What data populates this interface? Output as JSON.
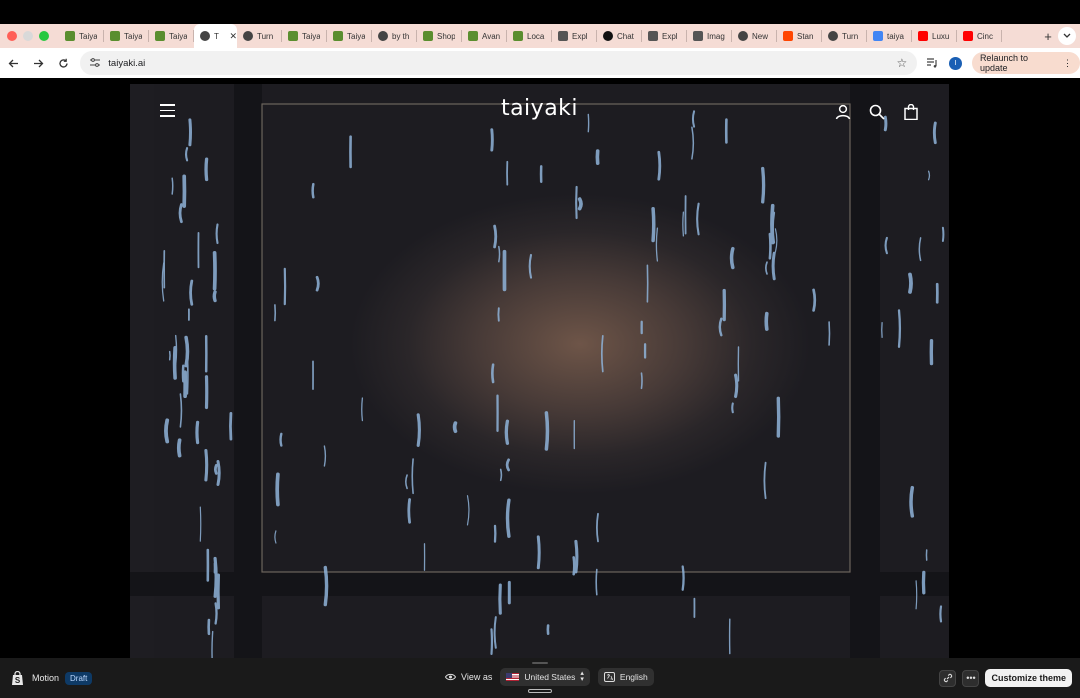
{
  "browser": {
    "tabs": [
      {
        "label": "Taiya",
        "icon": "shopify-icon",
        "color": "#5a8e2f"
      },
      {
        "label": "Taiya",
        "icon": "shopify-icon",
        "color": "#5a8e2f"
      },
      {
        "label": "Taiya",
        "icon": "shopify-icon",
        "color": "#5a8e2f"
      },
      {
        "label": "T",
        "icon": "globe-icon",
        "color": "#444444",
        "active": true
      },
      {
        "label": "Turn",
        "icon": "globe-icon",
        "color": "#444444"
      },
      {
        "label": "Taiya",
        "icon": "shopify-icon",
        "color": "#5a8e2f"
      },
      {
        "label": "Taiya",
        "icon": "shopify-icon",
        "color": "#5a8e2f"
      },
      {
        "label": "by th",
        "icon": "globe-icon",
        "color": "#444444"
      },
      {
        "label": "Shop",
        "icon": "shopify-icon",
        "color": "#5a8e2f"
      },
      {
        "label": "Avan",
        "icon": "shopify-icon",
        "color": "#5a8e2f"
      },
      {
        "label": "Loca",
        "icon": "shopify-icon",
        "color": "#5a8e2f"
      },
      {
        "label": "Expl",
        "icon": "ai-icon",
        "color": "#555555"
      },
      {
        "label": "Chat",
        "icon": "openai-icon",
        "color": "#111111"
      },
      {
        "label": "Expl",
        "icon": "ai-icon",
        "color": "#555555"
      },
      {
        "label": "Imag",
        "icon": "ai-icon",
        "color": "#555555"
      },
      {
        "label": "New",
        "icon": "globe-icon",
        "color": "#444444"
      },
      {
        "label": "Stan",
        "icon": "reddit-icon",
        "color": "#ff4500"
      },
      {
        "label": "Turn",
        "icon": "globe-icon",
        "color": "#444444"
      },
      {
        "label": "taiya",
        "icon": "google-icon",
        "color": "#4285f4"
      },
      {
        "label": "Luxu",
        "icon": "youtube-icon",
        "color": "#ff0000"
      },
      {
        "label": "Cinc",
        "icon": "youtube-icon",
        "color": "#ff0000"
      }
    ],
    "new_tab": "+",
    "close_glyph": "✕",
    "url": "taiyaki.ai",
    "profile_initial": "I",
    "relaunch_label": "Relaunch to update"
  },
  "site": {
    "logo": "taiyaki"
  },
  "admin_bar": {
    "theme_name": "Motion",
    "status_badge": "Draft",
    "view_as_label": "View as",
    "country": "United States",
    "language": "English",
    "customize_label": "Customize theme"
  },
  "colors": {
    "tab_strip": "#f5dcd5",
    "relaunch_bg": "#f8dccf",
    "admin_bar_bg": "#1a1a1a",
    "draft_badge_bg": "#0e3a66",
    "hero_warm": "#6e5548",
    "rain_streak": "#8fb3d9"
  }
}
